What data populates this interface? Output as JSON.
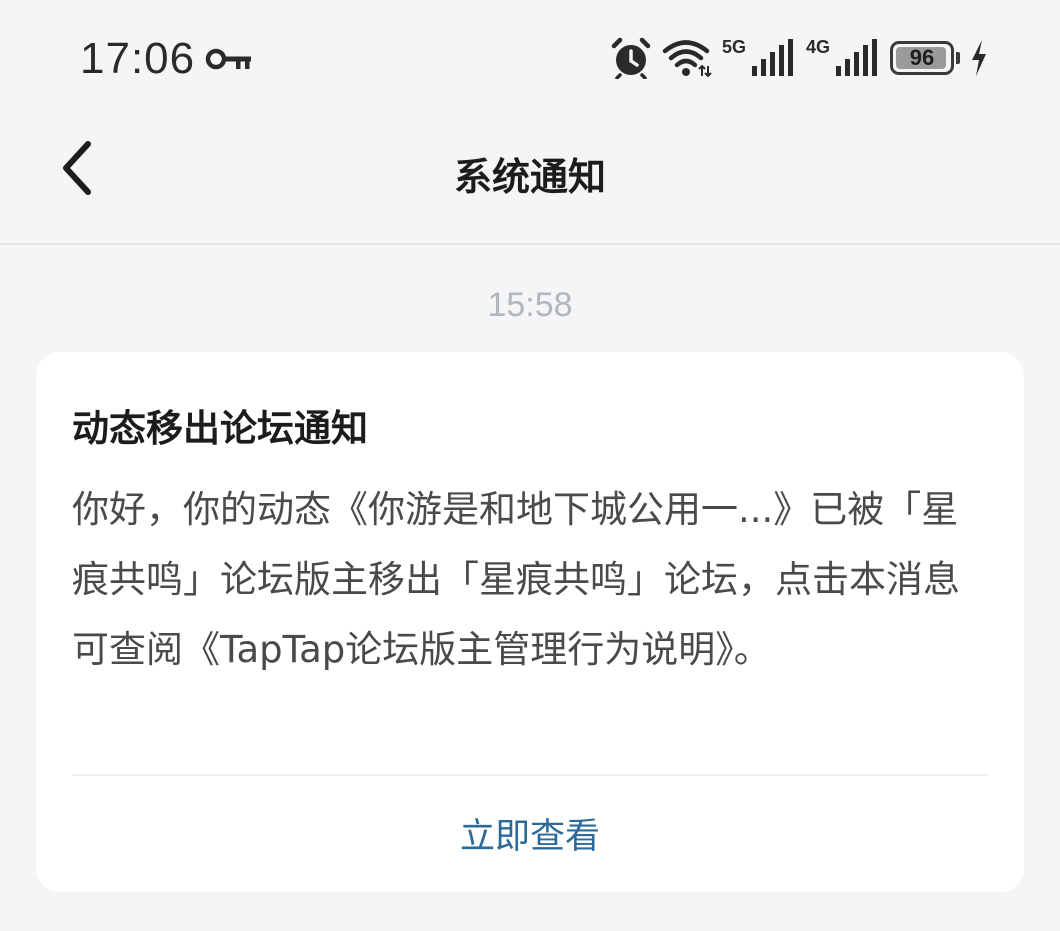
{
  "status_bar": {
    "time": "17:06",
    "network_5g_label": "5G",
    "network_4g_label": "4G",
    "battery_level": 96,
    "battery_text": "96",
    "icons": [
      "key-icon",
      "alarm-icon",
      "wifi-icon",
      "signal-icon",
      "signal-icon",
      "battery-icon",
      "charging-icon"
    ]
  },
  "nav": {
    "back_icon": "chevron-left-icon",
    "title": "系统通知"
  },
  "message": {
    "timestamp": "15:58",
    "title": "动态移出论坛通知",
    "body": "你好，你的动态《你游是和地下城公用一...》已被「星痕共鸣」论坛版主移出「星痕共鸣」论坛，点击本消息可查阅《TapTap论坛版主管理行为说明》。",
    "action_label": "立即查看"
  },
  "colors": {
    "background": "#f4f5f6",
    "card": "#ffffff",
    "link": "#2c6a99",
    "timestamp": "#b3b6ba"
  }
}
